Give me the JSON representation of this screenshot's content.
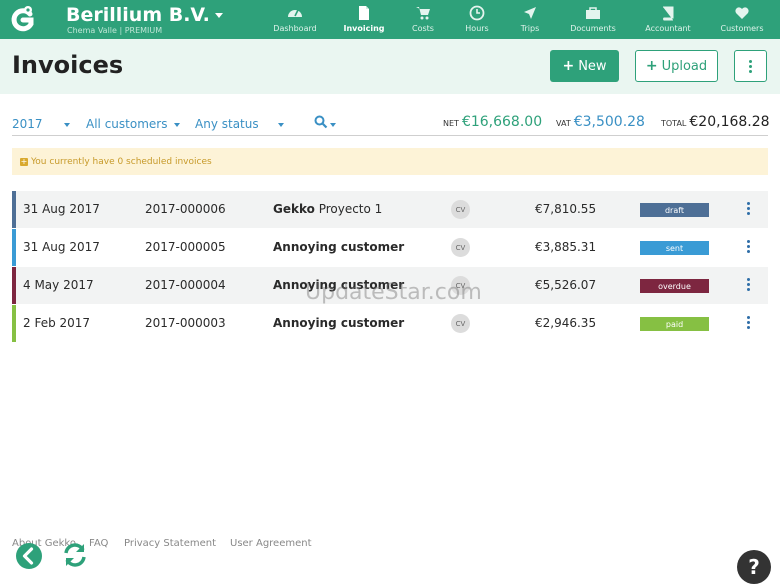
{
  "app": {
    "company": "Berillium B.V.",
    "subline": "Chema Valle | PREMIUM"
  },
  "nav": [
    {
      "label": "Dashboard",
      "icon": "dashboard-gauge-icon",
      "active": false
    },
    {
      "label": "Invoicing",
      "icon": "document-icon",
      "active": true
    },
    {
      "label": "Costs",
      "icon": "cart-icon",
      "active": false
    },
    {
      "label": "Hours",
      "icon": "clock-icon",
      "active": false
    },
    {
      "label": "Trips",
      "icon": "location-arrow-icon",
      "active": false
    },
    {
      "label": "Documents",
      "icon": "briefcase-icon",
      "active": false
    },
    {
      "label": "Accountant",
      "icon": "book-icon",
      "active": false
    },
    {
      "label": "Customers",
      "icon": "heart-icon",
      "active": false
    }
  ],
  "page": {
    "title": "Invoices",
    "new_label": "New",
    "upload_label": "Upload"
  },
  "filters": {
    "year": "2017",
    "customer": "All customers",
    "status": "Any status"
  },
  "totals": {
    "net_label": "NET",
    "net_value": "€16,668.00",
    "vat_label": "VAT",
    "vat_value": "€3,500.28",
    "total_label": "TOTAL",
    "total_value": "€20,168.28"
  },
  "notice": "You currently have 0 scheduled invoices",
  "invoices": [
    {
      "date": "31 Aug 2017",
      "number": "2017-000006",
      "customer_bold": "Gekko",
      "customer_rest": " Proyecto 1",
      "initials": "CV",
      "amount": "€7,810.55",
      "status": "draft"
    },
    {
      "date": "31 Aug 2017",
      "number": "2017-000005",
      "customer_bold": "Annoying customer",
      "customer_rest": "",
      "initials": "CV",
      "amount": "€3,885.31",
      "status": "sent"
    },
    {
      "date": "4 May 2017",
      "number": "2017-000004",
      "customer_bold": "Annoying customer",
      "customer_rest": "",
      "initials": "CV",
      "amount": "€5,526.07",
      "status": "overdue"
    },
    {
      "date": "2 Feb 2017",
      "number": "2017-000003",
      "customer_bold": "Annoying customer",
      "customer_rest": "",
      "initials": "CV",
      "amount": "€2,946.35",
      "status": "paid"
    }
  ],
  "status_colors": {
    "draft": "#4e6f96",
    "sent": "#3a9bd5",
    "overdue": "#7d2640",
    "paid": "#86c043"
  },
  "row_bar_colors": [
    "#4e6f96",
    "#3a9bd5",
    "#7d2640",
    "#86c043"
  ],
  "row_backgrounds": [
    "#f2f3f3",
    "#ffffff",
    "#f2f3f3",
    "#ffffff"
  ],
  "watermark": "UpdateStar.com",
  "footer": {
    "about": "About Gekko",
    "faq": "FAQ",
    "privacy": "Privacy Statement",
    "agreement": "User Agreement"
  },
  "help_label": "?",
  "colors": {
    "brand_green": "#2ea17a",
    "link_blue": "#3a90c4"
  }
}
